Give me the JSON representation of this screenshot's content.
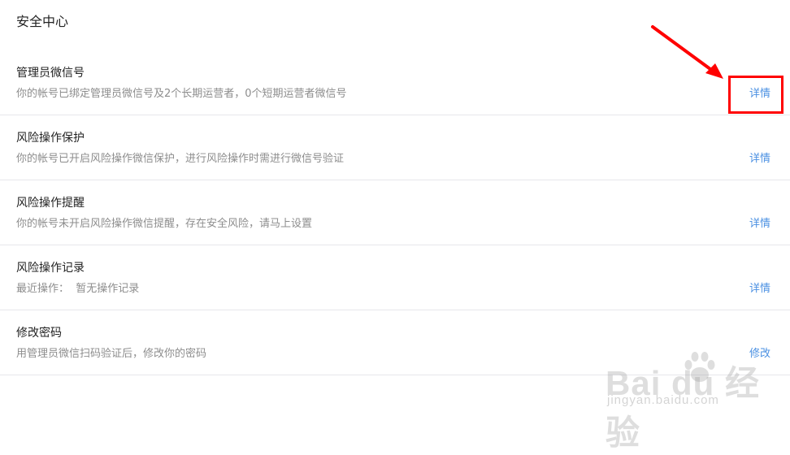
{
  "page": {
    "title": "安全中心"
  },
  "items": [
    {
      "title": "管理员微信号",
      "desc": "你的帐号已绑定管理员微信号及2个长期运营者，0个短期运营者微信号",
      "action": "详情"
    },
    {
      "title": "风险操作保护",
      "desc": "你的帐号已开启风险操作微信保护，进行风险操作时需进行微信号验证",
      "action": "详情"
    },
    {
      "title": "风险操作提醒",
      "desc": "你的帐号未开启风险操作微信提醒，存在安全风险，请马上设置",
      "action": "详情"
    },
    {
      "title": "风险操作记录",
      "desc": "最近操作：  暂无操作记录",
      "action": "详情"
    },
    {
      "title": "修改密码",
      "desc": "用管理员微信扫码验证后，修改你的密码",
      "action": "修改"
    }
  ],
  "annotation": {
    "color": "#ff0000"
  },
  "watermark": {
    "brand": "Bai  du 经验",
    "url": "jingyan.baidu.com"
  },
  "colors": {
    "link": "#4a90e2",
    "divider": "#e7e7eb",
    "desc": "#8d8d8d"
  }
}
